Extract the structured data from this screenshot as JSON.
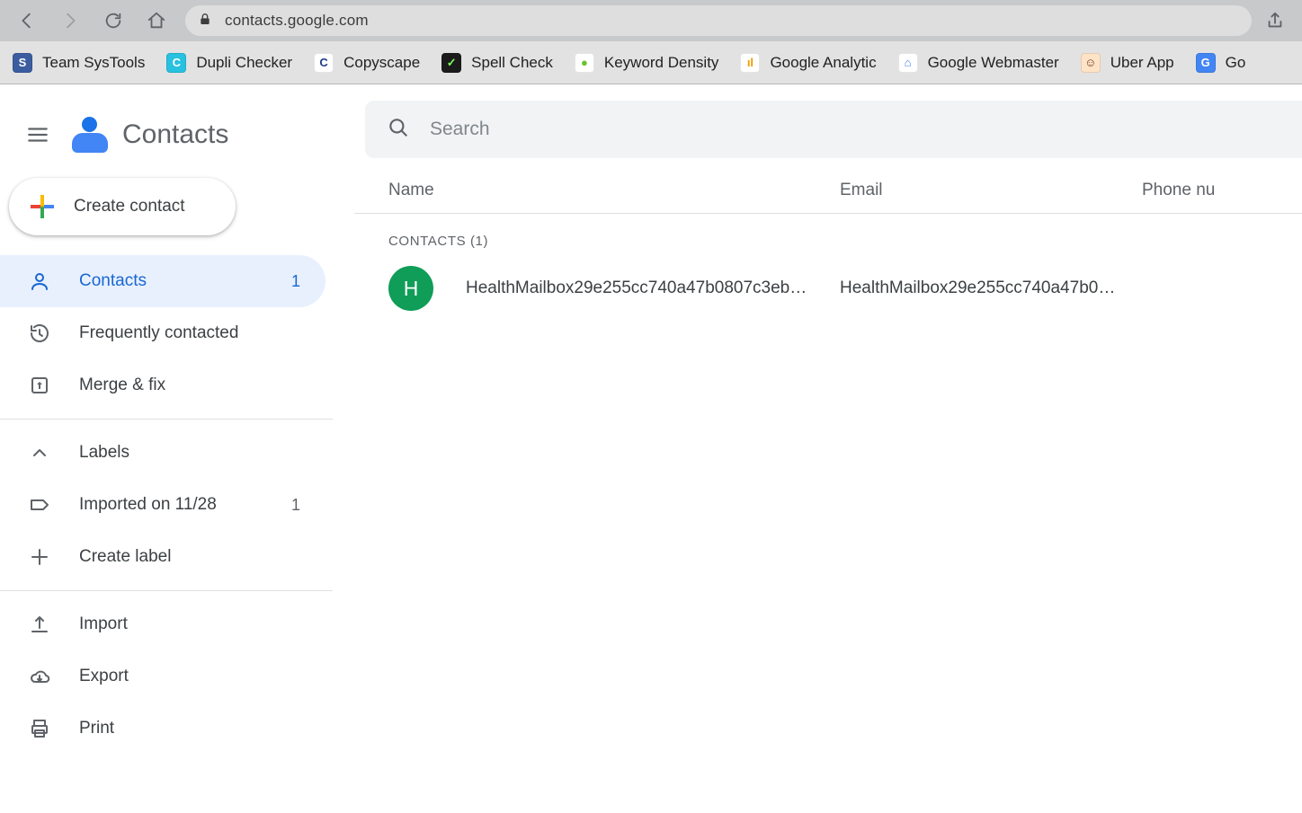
{
  "browser": {
    "url": "contacts.google.com",
    "bookmarks": [
      {
        "label": "Team SysTools",
        "bg": "#3b5da0",
        "fg": "#fff",
        "glyph": "S"
      },
      {
        "label": "Dupli Checker",
        "bg": "#28c1e0",
        "fg": "#fff",
        "glyph": "C"
      },
      {
        "label": "Copyscape",
        "bg": "#ffffff",
        "fg": "#203a8a",
        "glyph": "C"
      },
      {
        "label": "Spell Check",
        "bg": "#1b1b1b",
        "fg": "#7cff5a",
        "glyph": "✓"
      },
      {
        "label": "Keyword Density",
        "bg": "#ffffff",
        "fg": "#6ac22e",
        "glyph": "●"
      },
      {
        "label": "Google Analytic",
        "bg": "#ffffff",
        "fg": "#f29900",
        "glyph": "ıl"
      },
      {
        "label": "Google Webmaster",
        "bg": "#ffffff",
        "fg": "#4285f4",
        "glyph": "⌂"
      },
      {
        "label": "Uber App",
        "bg": "#ffe3c7",
        "fg": "#6b3a1f",
        "glyph": "☺"
      },
      {
        "label": "Go",
        "bg": "#4285f4",
        "fg": "#fff",
        "glyph": "G"
      }
    ]
  },
  "app": {
    "title": "Contacts",
    "create_label": "Create contact",
    "search_placeholder": "Search"
  },
  "sidebar": {
    "items": [
      {
        "icon": "person",
        "label": "Contacts",
        "count": "1",
        "active": true
      },
      {
        "icon": "history",
        "label": "Frequently contacted",
        "count": "",
        "active": false
      },
      {
        "icon": "merge",
        "label": "Merge & fix",
        "count": "",
        "active": false
      }
    ],
    "labels_header": "Labels",
    "labels": [
      {
        "icon": "tag",
        "label": "Imported on 11/28",
        "count": "1"
      }
    ],
    "create_label_label": "Create label",
    "actions": [
      {
        "icon": "upload",
        "label": "Import"
      },
      {
        "icon": "cloud",
        "label": "Export"
      },
      {
        "icon": "print",
        "label": "Print"
      }
    ]
  },
  "columns": {
    "name": "Name",
    "email": "Email",
    "phone": "Phone nu"
  },
  "section": {
    "label": "CONTACTS (1)"
  },
  "contacts": [
    {
      "initial": "H",
      "avatar_bg": "#0f9d58",
      "name": "HealthMailbox29e255cc740a47b0807c3eb…",
      "email": "HealthMailbox29e255cc740a47b0…"
    }
  ]
}
